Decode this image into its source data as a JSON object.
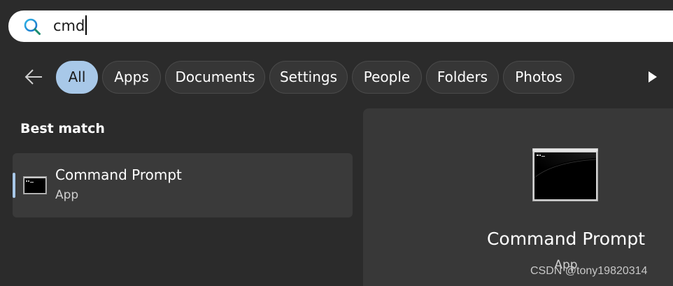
{
  "search": {
    "query": "cmd"
  },
  "filters": [
    {
      "label": "All",
      "active": true
    },
    {
      "label": "Apps"
    },
    {
      "label": "Documents"
    },
    {
      "label": "Settings"
    },
    {
      "label": "People"
    },
    {
      "label": "Folders"
    },
    {
      "label": "Photos"
    }
  ],
  "best_match": {
    "section_title": "Best match",
    "item": {
      "title": "Command Prompt",
      "subtitle": "App",
      "icon": "command-prompt-icon"
    }
  },
  "detail": {
    "title": "Command Prompt",
    "subtitle": "App",
    "icon": "command-prompt-icon"
  },
  "watermark": "CSDN @tony19820314",
  "colors": {
    "accent": "#a8c8e8",
    "background": "#2b2b2b",
    "search_icon": "#1f87d6"
  }
}
